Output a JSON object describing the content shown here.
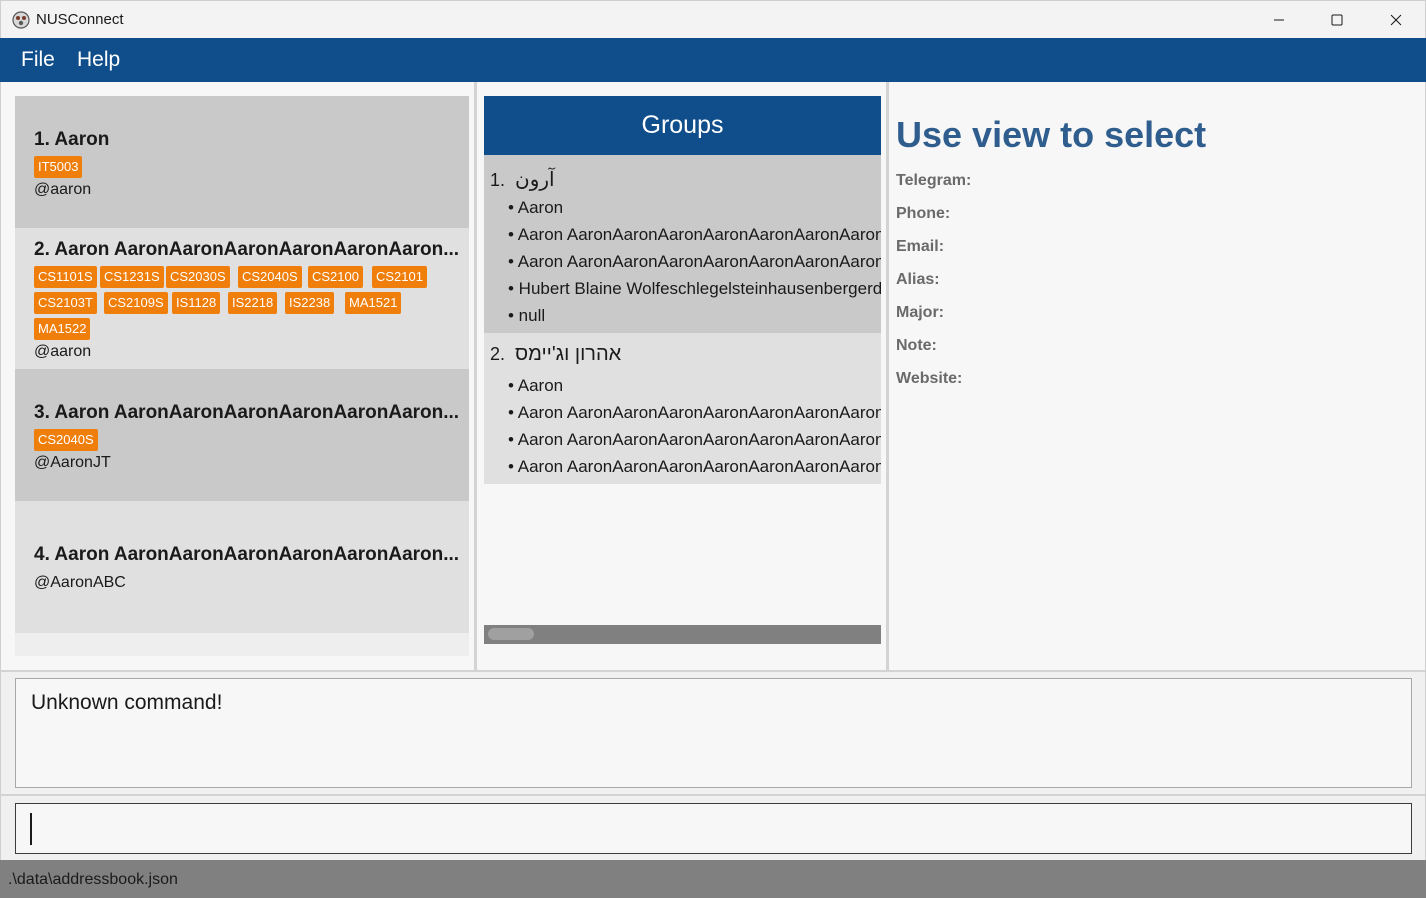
{
  "window": {
    "title": "NUSConnect"
  },
  "menu": {
    "file": "File",
    "help": "Help"
  },
  "persons": [
    {
      "name": "1. Aaron",
      "tags": [
        "IT5003"
      ],
      "handle": "@aaron"
    },
    {
      "name": "2. Aaron AaronAaronAaronAaronAaronAaron...",
      "tags": [
        "CS1101S",
        "CS1231S",
        "CS2030S",
        "CS2040S",
        "CS2100",
        "CS2101",
        "CS2103T",
        "CS2109S",
        "IS1128",
        "IS2218",
        "IS2238",
        "MA1521",
        "MA1522"
      ],
      "handle": "@aaron"
    },
    {
      "name": "3. Aaron AaronAaronAaronAaronAaronAaron...",
      "tags": [
        "CS2040S"
      ],
      "handle": "@AaronJT"
    },
    {
      "name": "4. Aaron AaronAaronAaronAaronAaronAaron...",
      "tags": [],
      "handle": "@AaronABC"
    }
  ],
  "groups": {
    "header": "Groups",
    "items": [
      {
        "number": "1.",
        "name": "آرون",
        "members": [
          "• Aaron",
          "• Aaron AaronAaronAaronAaronAaronAaronAaron",
          "• Aaron AaronAaronAaronAaronAaronAaronAaron",
          "• Hubert Blaine Wolfeschlegelsteinhausenbergerdorff",
          "• null"
        ]
      },
      {
        "number": "2.",
        "name": "אהרון וג'יימס",
        "members": [
          "• Aaron",
          "• Aaron AaronAaronAaronAaronAaronAaronAaron",
          "• Aaron AaronAaronAaronAaronAaronAaronAaron",
          "• Aaron AaronAaronAaronAaronAaronAaronAaron"
        ]
      }
    ]
  },
  "detail": {
    "title": "Use view to select",
    "labels": {
      "telegram": "Telegram:",
      "phone": "Phone:",
      "email": "Email:",
      "alias": "Alias:",
      "major": "Major:",
      "note": "Note:",
      "website": "Website:"
    }
  },
  "result": {
    "message": "Unknown command!"
  },
  "command": {
    "value": "",
    "placeholder": ""
  },
  "status": {
    "path": ".\\data\\addressbook.json"
  },
  "colors": {
    "accent": "#104e8b",
    "tag": "#ef7e0a",
    "detail_title": "#2f5e8e"
  }
}
